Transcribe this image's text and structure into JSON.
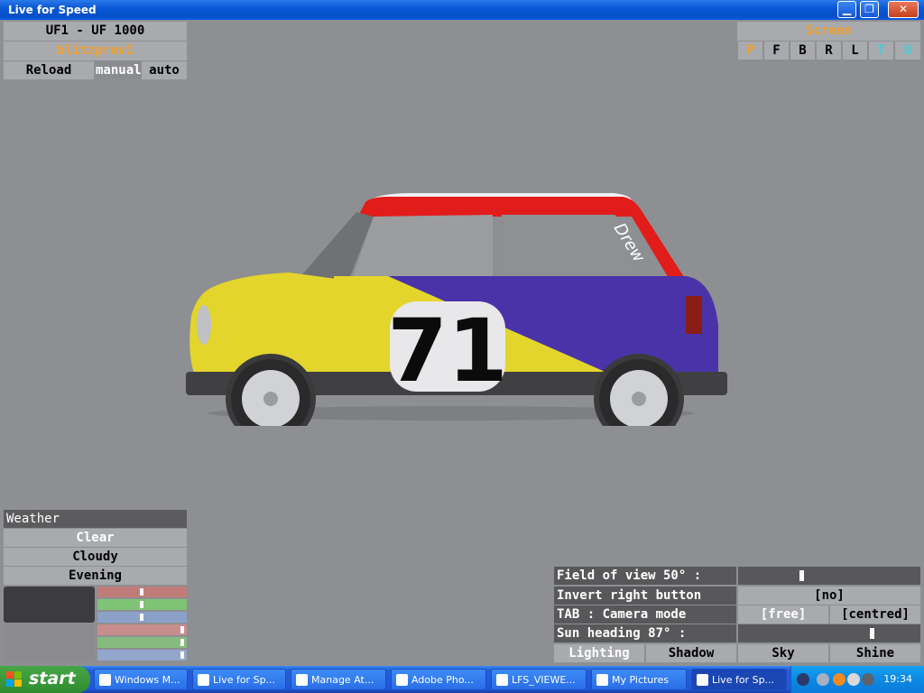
{
  "window": {
    "title": "Live for Speed"
  },
  "top_left": {
    "car_name": "UF1 - UF 1000",
    "skin_name": "blitzprev1",
    "reload_label": "Reload",
    "manual_label": "manual",
    "auto_label": "auto"
  },
  "screen_panel": {
    "title": "Screen",
    "views": [
      "P",
      "F",
      "B",
      "R",
      "L",
      "T",
      "U"
    ]
  },
  "car": {
    "number": "71",
    "text": "Drew"
  },
  "weather": {
    "title": "Weather",
    "options": [
      "Clear",
      "Cloudy",
      "Evening"
    ]
  },
  "view_options": {
    "fov_label": "Field of view 50° :",
    "invert_label": "Invert right button look :",
    "invert_value": "[no]",
    "camera_label": "TAB : Camera mode",
    "camera_free": "[free]",
    "camera_centred": "[centred]",
    "sun_label": "Sun heading 87° :",
    "tabs": [
      "Lighting",
      "Shadow",
      "Sky",
      "Shine"
    ]
  },
  "taskbar": {
    "start_label": "start",
    "items": [
      "Windows M...",
      "Live for Sp...",
      "Manage At...",
      "Adobe Pho...",
      "LFS_VIEWE...",
      "My Pictures",
      "Live for Sp..."
    ],
    "clock": "19:34"
  }
}
